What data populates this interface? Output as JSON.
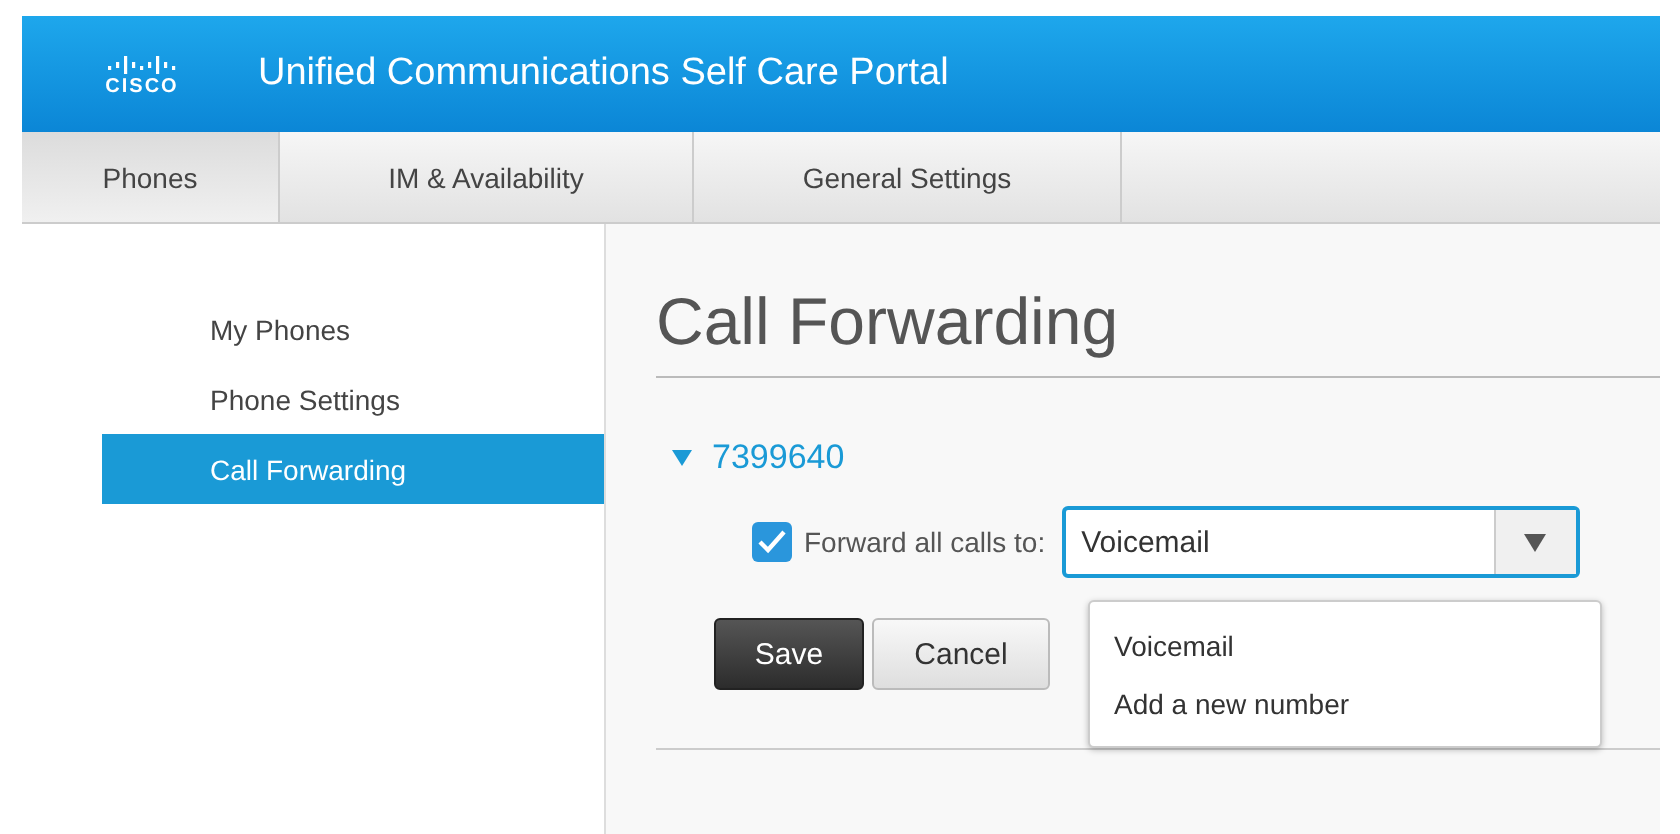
{
  "header": {
    "logo_text": "CISCO",
    "title": "Unified Communications Self Care Portal"
  },
  "tabs": [
    {
      "label": "Phones",
      "selected": true
    },
    {
      "label": "IM & Availability",
      "selected": false
    },
    {
      "label": "General Settings",
      "selected": false
    }
  ],
  "sidebar": {
    "items": [
      {
        "label": "My Phones",
        "selected": false
      },
      {
        "label": "Phone Settings",
        "selected": false
      },
      {
        "label": "Call Forwarding",
        "selected": true
      }
    ]
  },
  "content": {
    "title": "Call Forwarding",
    "line": {
      "number": "7399640",
      "expanded": true
    },
    "forward": {
      "label": "Forward all calls to:",
      "checked": true,
      "value": "Voicemail"
    },
    "dropdown": {
      "open": true,
      "options": [
        "Voicemail",
        "Add a new number"
      ]
    },
    "buttons": [
      {
        "label": "Save",
        "kind": "primary"
      },
      {
        "label": "Cancel",
        "kind": "secondary"
      }
    ]
  }
}
